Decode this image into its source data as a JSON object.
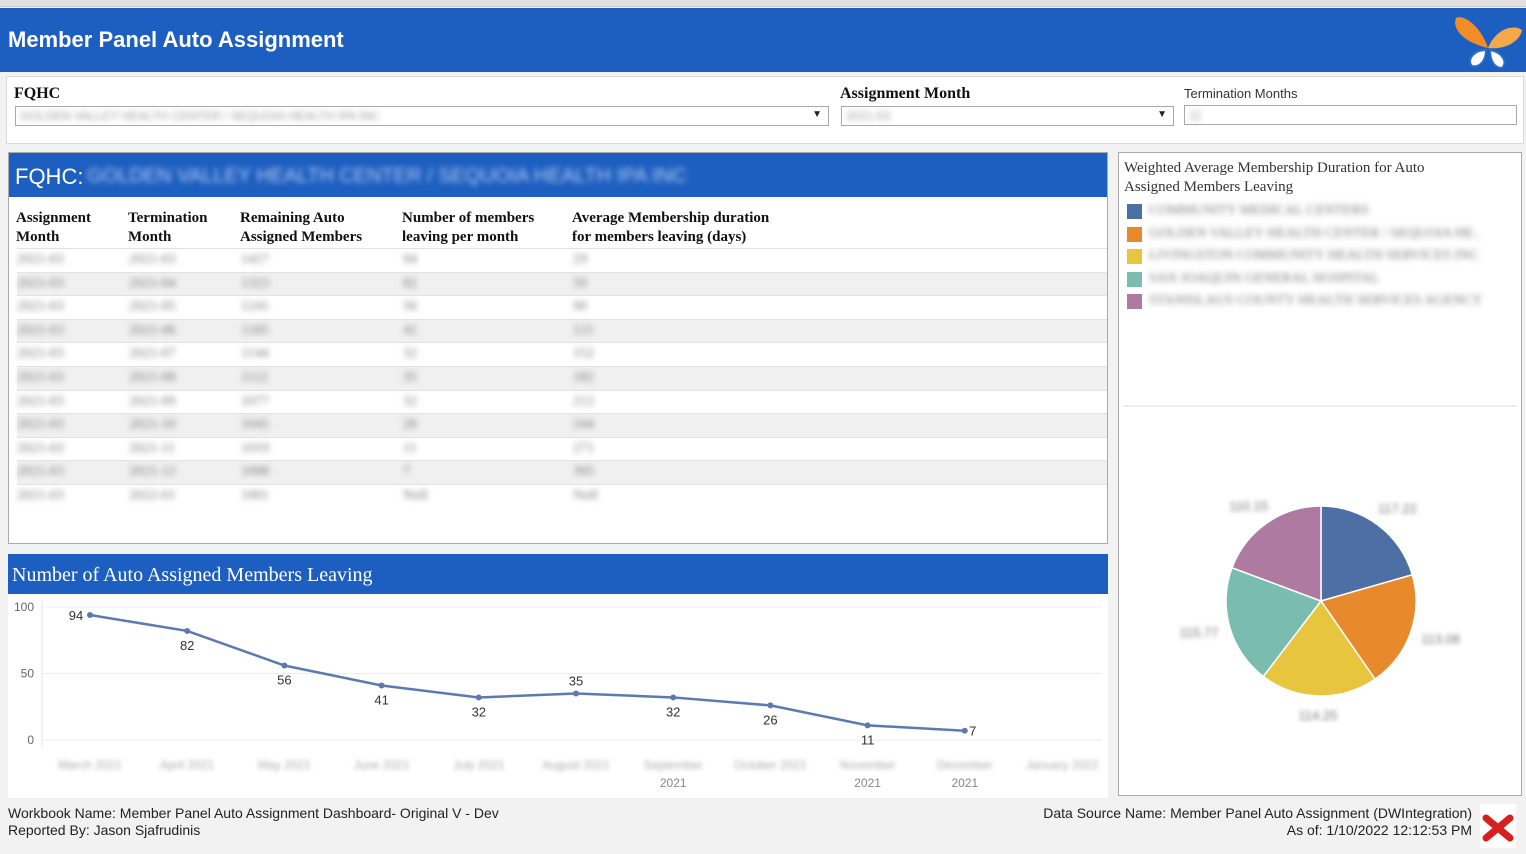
{
  "header": {
    "title": "Member Panel Auto Assignment",
    "logo": "butterfly-logo"
  },
  "filters": {
    "fqhc": {
      "label": "FQHC",
      "value": "GOLDEN VALLEY HEALTH CENTER / SEQUOIA HEALTH IPA INC"
    },
    "assignment_month": {
      "label": "Assignment Month",
      "value": "2021-03"
    },
    "termination_months": {
      "label": "Termination Months",
      "value": "11"
    }
  },
  "table_panel": {
    "title_prefix": "FQHC:",
    "title_value": "GOLDEN VALLEY HEALTH CENTER / SEQUOIA HEALTH IPA INC",
    "columns": [
      [
        "Assignment",
        "Month"
      ],
      [
        "Termination",
        "Month"
      ],
      [
        "Remaining Auto",
        "Assigned Members"
      ],
      [
        "Number of members",
        "leaving per month"
      ],
      [
        "Average Membership duration",
        "for members leaving (days)"
      ]
    ],
    "rows": [
      [
        "2021-03",
        "2021-03",
        "1417",
        "94",
        "29"
      ],
      [
        "2021-03",
        "2021-04",
        "1323",
        "82",
        "59"
      ],
      [
        "2021-03",
        "2021-05",
        "1241",
        "56",
        "90"
      ],
      [
        "2021-03",
        "2021-06",
        "1185",
        "41",
        "121"
      ],
      [
        "2021-03",
        "2021-07",
        "1144",
        "32",
        "152"
      ],
      [
        "2021-03",
        "2021-08",
        "1112",
        "35",
        "182"
      ],
      [
        "2021-03",
        "2021-09",
        "1077",
        "32",
        "212"
      ],
      [
        "2021-03",
        "2021-10",
        "1045",
        "26",
        "244"
      ],
      [
        "2021-03",
        "2021-11",
        "1019",
        "11",
        "271"
      ],
      [
        "2021-03",
        "2021-12",
        "1008",
        "7",
        "305"
      ],
      [
        "2021-03",
        "2022-01",
        "1001",
        "Null",
        "Null"
      ]
    ]
  },
  "chart_panel": {
    "title": "Number of Auto Assigned Members Leaving"
  },
  "chart_data": [
    {
      "type": "line",
      "title": "Number of Auto Assigned Members Leaving",
      "categories": [
        "March 2021",
        "April 2021",
        "May 2021",
        "June 2021",
        "July 2021",
        "August 2021",
        "September 2021",
        "October 2021",
        "November 2021",
        "December 2021",
        "January 2022"
      ],
      "values": [
        94,
        82,
        56,
        41,
        32,
        35,
        32,
        26,
        11,
        7,
        null
      ],
      "y_ticks": [
        0,
        50,
        100
      ],
      "ylim": [
        0,
        100
      ],
      "color": "#5b7ab0",
      "grid": true
    },
    {
      "type": "pie",
      "title": "Weighted Average Membership Duration for Auto Assigned Members Leaving",
      "labels": [
        "COMMUNITY MEDICAL CENTERS",
        "GOLDEN VALLEY HEALTH CENTER / SEQUOIA HE..",
        "LIVINGSTON COMMUNITY HEALTH SERVICES INC",
        "SAN JOAQUIN GENERAL HOSPITAL",
        "STANISLAUS COUNTY HEALTH SERVICES AGENCY"
      ],
      "values": [
        117.22,
        113.08,
        114.25,
        115.77,
        110.15
      ],
      "colors": [
        "#4e6fa3",
        "#e8892c",
        "#e8c53e",
        "#7bbcb0",
        "#ae7aa1"
      ]
    }
  ],
  "pie_panel": {
    "title": "Weighted Average Membership Duration for Auto Assigned Members Leaving"
  },
  "footer": {
    "workbook": "Workbook Name: Member Panel Auto Assignment Dashboard- Original V - Dev",
    "reported_by": "Reported By: Jason Sjafrudinis",
    "data_source": "Data Source Name: Member Panel Auto Assignment (DWIntegration)",
    "as_of": "As of: 1/10/2022 12:12:53 PM",
    "icon": "tableau-export-icon"
  }
}
